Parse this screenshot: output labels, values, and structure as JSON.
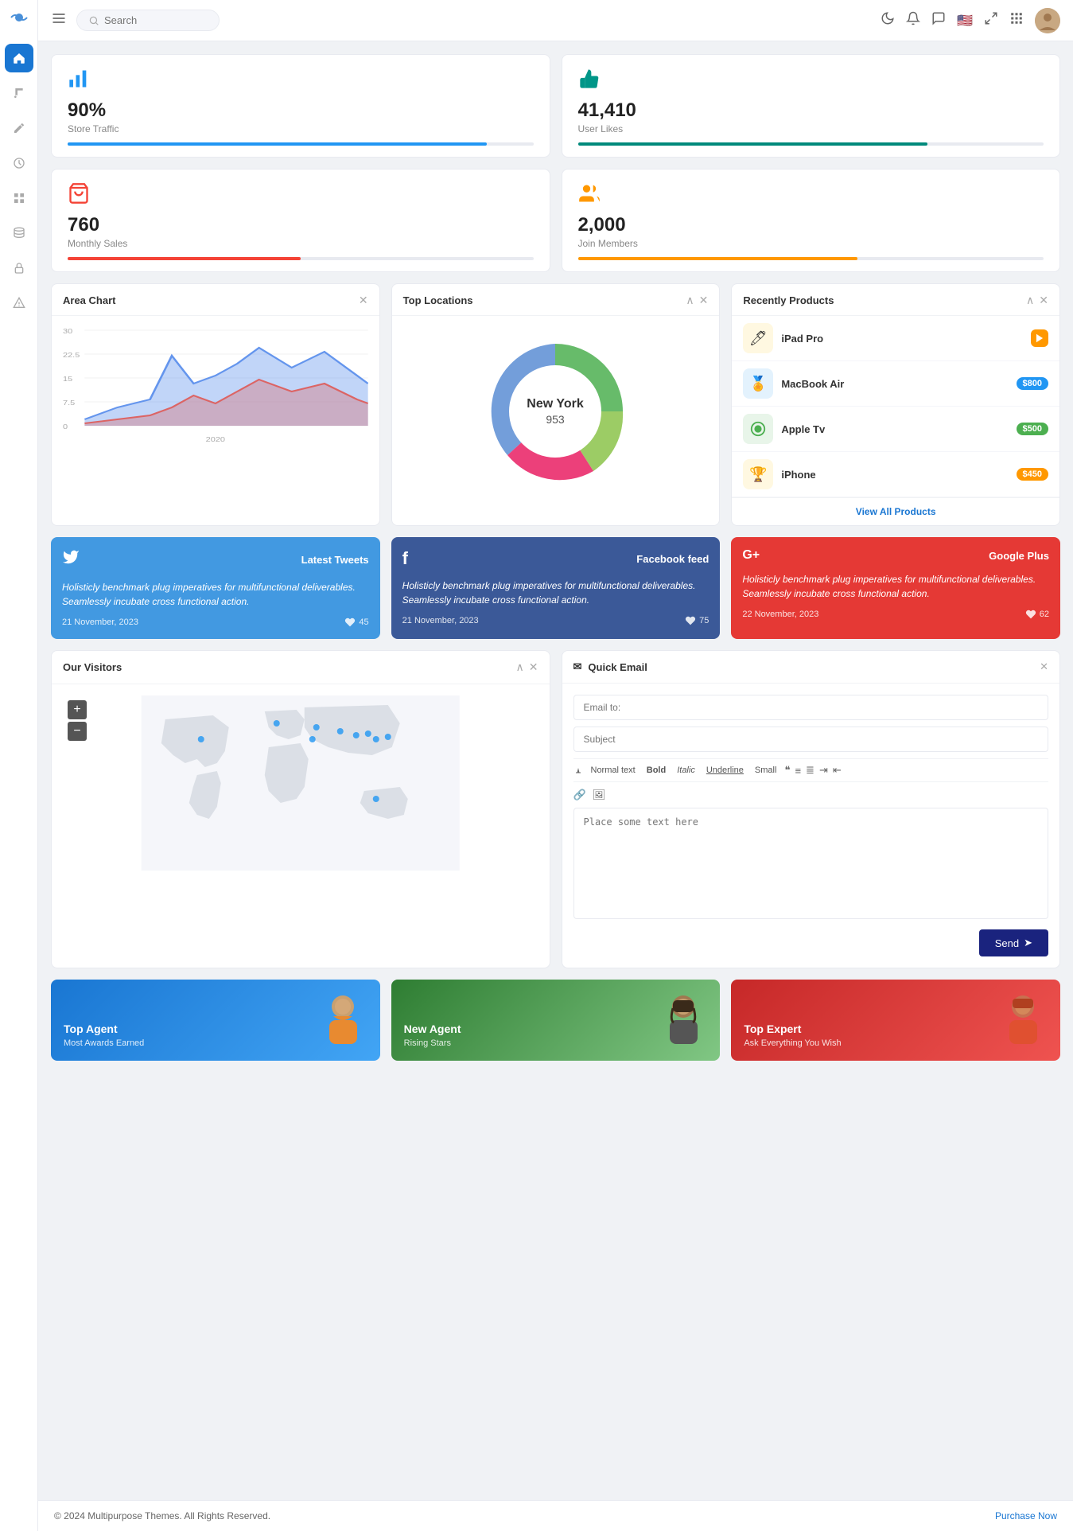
{
  "sidebar": {
    "logo": "◎",
    "items": [
      {
        "id": "home",
        "icon": "⌂",
        "active": true
      },
      {
        "id": "music",
        "icon": "♪",
        "active": false
      },
      {
        "id": "edit",
        "icon": "✎",
        "active": false
      },
      {
        "id": "clock",
        "icon": "◷",
        "active": false
      },
      {
        "id": "grid",
        "icon": "⊞",
        "active": false
      },
      {
        "id": "database",
        "icon": "▤",
        "active": false
      },
      {
        "id": "lock",
        "icon": "🔒",
        "active": false
      },
      {
        "id": "alert",
        "icon": "△",
        "active": false
      }
    ]
  },
  "header": {
    "search_placeholder": "Search",
    "moon_icon": "☽",
    "bell_icon": "🔔",
    "chat_icon": "💬",
    "flag_icon": "🇺🇸",
    "expand_icon": "⛶",
    "grid_icon": "⊞"
  },
  "stats": [
    {
      "id": "store-traffic",
      "icon": "📊",
      "icon_color": "#2196f3",
      "value": "90%",
      "label": "Store Traffic",
      "bar_width": "90",
      "bar_color": "bar-blue"
    },
    {
      "id": "user-likes",
      "icon": "👍",
      "icon_color": "#009688",
      "value": "41,410",
      "label": "User Likes",
      "bar_width": "75",
      "bar_color": "bar-green"
    },
    {
      "id": "monthly-sales",
      "icon": "🛍",
      "icon_color": "#f44336",
      "value": "760",
      "label": "Monthly Sales",
      "bar_width": "50",
      "bar_color": "bar-red"
    },
    {
      "id": "join-members",
      "icon": "👥",
      "icon_color": "#ff9800",
      "value": "2,000",
      "label": "Join Members",
      "bar_width": "60",
      "bar_color": "bar-orange"
    }
  ],
  "area_chart": {
    "title": "Area Chart",
    "year_label": "2020",
    "y_labels": [
      "30",
      "22.5",
      "15",
      "7.5",
      "0"
    ]
  },
  "top_locations": {
    "title": "Top Locations",
    "center_label": "New York",
    "center_value": "953"
  },
  "recently_products": {
    "title": "Recently Products",
    "view_all": "View All Products",
    "products": [
      {
        "name": "iPad Pro",
        "icon": "🖊",
        "icon_bg": "#fff8e1",
        "price": null,
        "price_color": "#ff9800",
        "has_arrow": true
      },
      {
        "name": "MacBook Air",
        "icon": "🏅",
        "icon_bg": "#e3f2fd",
        "price": "$800",
        "price_color": "#2196f3"
      },
      {
        "name": "Apple Tv",
        "icon": "⚙",
        "icon_bg": "#e8f5e9",
        "price": "$500",
        "price_color": "#4caf50"
      },
      {
        "name": "iPhone",
        "icon": "🏆",
        "icon_bg": "#fff8e1",
        "price": "$450",
        "price_color": "#ff9800"
      }
    ]
  },
  "social_cards": [
    {
      "id": "twitter",
      "type": "twitter",
      "icon": "🐦",
      "title": "Latest Tweets",
      "text": "Holisticly benchmark plug imperatives for multifunctional deliverables. Seamlessly incubate cross functional action.",
      "date": "21 November, 2023",
      "likes": "45"
    },
    {
      "id": "facebook",
      "type": "facebook",
      "icon": "f",
      "title": "Facebook feed",
      "text": "Holisticly benchmark plug imperatives for multifunctional deliverables. Seamlessly incubate cross functional action.",
      "date": "21 November, 2023",
      "likes": "75"
    },
    {
      "id": "google",
      "type": "google",
      "icon": "G+",
      "title": "Google Plus",
      "text": "Holisticly benchmark plug imperatives for multifunctional deliverables. Seamlessly incubate cross functional action.",
      "date": "22 November, 2023",
      "likes": "62"
    }
  ],
  "visitors_widget": {
    "title": "Our Visitors",
    "zoom_in": "+",
    "zoom_out": "−"
  },
  "quick_email": {
    "title": "Quick Email",
    "icon": "✉",
    "email_to_placeholder": "Email to:",
    "subject_placeholder": "Subject",
    "toolbar": {
      "normal_text": "Normal text",
      "bold": "Bold",
      "italic": "Italic",
      "underline": "Underline",
      "small": "Small",
      "quote_icon": "❝",
      "list1_icon": "≡",
      "list2_icon": "≣",
      "indent_icon": "⇥",
      "outdent_icon": "⇤",
      "link_icon": "🔗",
      "image_icon": "🖼"
    },
    "textarea_placeholder": "Place some text here",
    "send_label": "Send",
    "send_icon": "➤"
  },
  "agents": [
    {
      "id": "top-agent",
      "title": "Top Agent",
      "subtitle": "Most Awards Earned",
      "card_class": "blue"
    },
    {
      "id": "new-agent",
      "title": "New Agent",
      "subtitle": "Rising Stars",
      "card_class": "green"
    },
    {
      "id": "top-expert",
      "title": "Top Expert",
      "subtitle": "Ask Everything You Wish",
      "card_class": "red"
    }
  ],
  "footer": {
    "copyright": "© 2024 Multipurpose Themes. All Rights Reserved.",
    "purchase_label": "Purchase Now"
  }
}
